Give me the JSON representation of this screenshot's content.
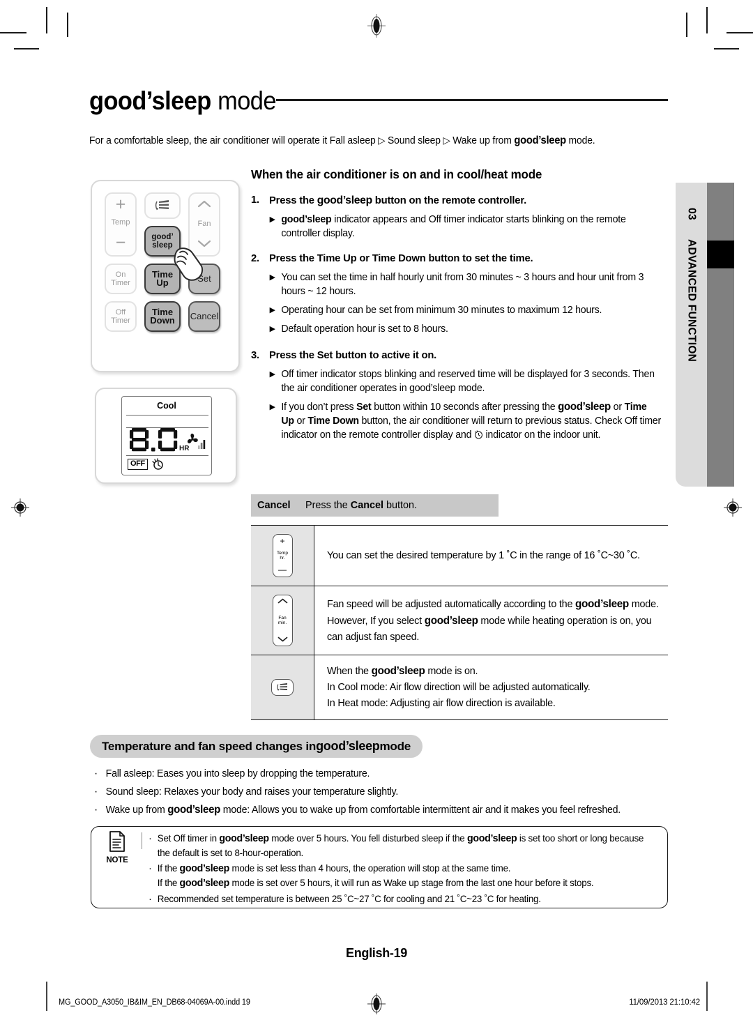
{
  "title": {
    "bold": "good’sleep",
    "light": "mode"
  },
  "intro": "For a comfortable sleep, the air conditioner will operate it Fall asleep ▷ Sound sleep ▷ Wake up from good’sleep mode.",
  "side_tab": {
    "number": "03",
    "label": "ADVANCED FUNCTION"
  },
  "remote": {
    "buttons": [
      {
        "name": "temp",
        "plus": "+",
        "label": "Temp",
        "minus": "−"
      },
      {
        "name": "swing",
        "label": ""
      },
      {
        "name": "fan",
        "label": "Fan"
      },
      {
        "name": "goodsleep",
        "line1": "good’",
        "line2": "sleep"
      },
      {
        "name": "on-timer",
        "line1": "On",
        "line2": "Timer"
      },
      {
        "name": "time-up",
        "line1": "Time",
        "line2": "Up"
      },
      {
        "name": "set",
        "label": "Set"
      },
      {
        "name": "off-timer",
        "line1": "Off",
        "line2": "Timer"
      },
      {
        "name": "time-down",
        "line1": "Time",
        "line2": "Down"
      },
      {
        "name": "cancel",
        "label": "Cancel"
      }
    ]
  },
  "lcd": {
    "mode": "Cool",
    "value": "8.0",
    "unit": "HR",
    "off_badge": "OFF"
  },
  "section1": {
    "heading": "When the air conditioner is on and in cool/heat mode",
    "steps": [
      {
        "num": "1.",
        "text_before": "Press the ",
        "emphasis": "good’sleep",
        "text_after": " button on the remote controller.",
        "bullets": [
          "good’sleep indicator appears and Off timer indicator starts blinking on the remote controller display."
        ]
      },
      {
        "num": "2.",
        "text": "Press the Time Up or Time Down button to set the time.",
        "bullets": [
          "You can set the time in half hourly unit from 30 minutes ~ 3 hours and hour unit from 3 hours ~ 12 hours.",
          "Operating hour can be set from minimum 30 minutes to maximum 12 hours.",
          "Default operation hour is set to 8 hours."
        ]
      },
      {
        "num": "3.",
        "text": "Press the Set button to active it on.",
        "bullets": [
          "Off timer indicator stops blinking and reserved time will be displayed for 3 seconds. Then the air conditioner operates in good’sleep mode.",
          "If you don’t press Set button within 10 seconds after pressing the good’sleep or Time Up or Time Down button, the air conditioner will return to previous status. Check Off timer indicator on the remote controller display and ⏱ indicator on the indoor unit."
        ]
      }
    ]
  },
  "cancel_row": {
    "title": "Cancel",
    "description_before": "Press the ",
    "description_bold": "Cancel",
    "description_after": " button."
  },
  "icon_table": {
    "rows": [
      {
        "icon": "temp-updown-button-icon",
        "icon_labels": [
          "Temp",
          "hr."
        ],
        "lines": [
          "You can set the desired temperature by 1 ˚C in the range of 16 ˚C~30 ˚C."
        ]
      },
      {
        "icon": "fan-updown-button-icon",
        "icon_labels": [
          "Fan",
          "min."
        ],
        "lines": [
          "Fan speed will be adjusted automatically according to the good’sleep mode.",
          "However, If you select good’sleep mode while heating operation is on, you can adjust fan speed."
        ]
      },
      {
        "icon": "air-swing-button-icon",
        "icon_labels": [],
        "lines": [
          "When the good’sleep mode is on.",
          "In Cool mode: Air flow direction will be adjusted automatically.",
          "In Heat mode: Adjusting air flow direction is available."
        ]
      }
    ]
  },
  "section2": {
    "banner_before": "Temperature and fan speed changes in ",
    "banner_emphasis": "good’sleep",
    "banner_after": " mode",
    "items": [
      "Fall asleep: Eases you into sleep by dropping the temperature.",
      "Sound sleep: Relaxes your body and raises your temperature slightly.",
      "Wake up from good’sleep mode: Allows you to wake up from comfortable intermittent air and it makes you feel refreshed."
    ]
  },
  "note": {
    "label": "NOTE",
    "items": [
      "Set Off timer in good’sleep mode over 5 hours. You fell disturbed sleep if the good’sleep is set too short or long because the default is set to 8-hour-operation.",
      "If the good’sleep mode is set less than 4 hours, the operation will stop at the same time.\nIf the good’sleep mode is set over 5 hours, it will run as Wake up stage from the last one hour before it stops.",
      "Recommended set temperature is between 25 ˚C~27 ˚C for cooling and 21 ˚C~23 ˚C for heating."
    ]
  },
  "footer": {
    "page_label": "English-19",
    "file": "MG_GOOD_A3050_IB&IM_EN_DB68-04069A-00.indd   19",
    "date": "11/09/2013   21:10:42"
  },
  "colors": {
    "tab_light": "#dcdcdc",
    "tab_dark": "#808080",
    "tab_marker": "#000000",
    "cancel_bar": "#c8c8c8",
    "banner": "#cfcfcf",
    "icon_cell": "#e4e4e4"
  }
}
